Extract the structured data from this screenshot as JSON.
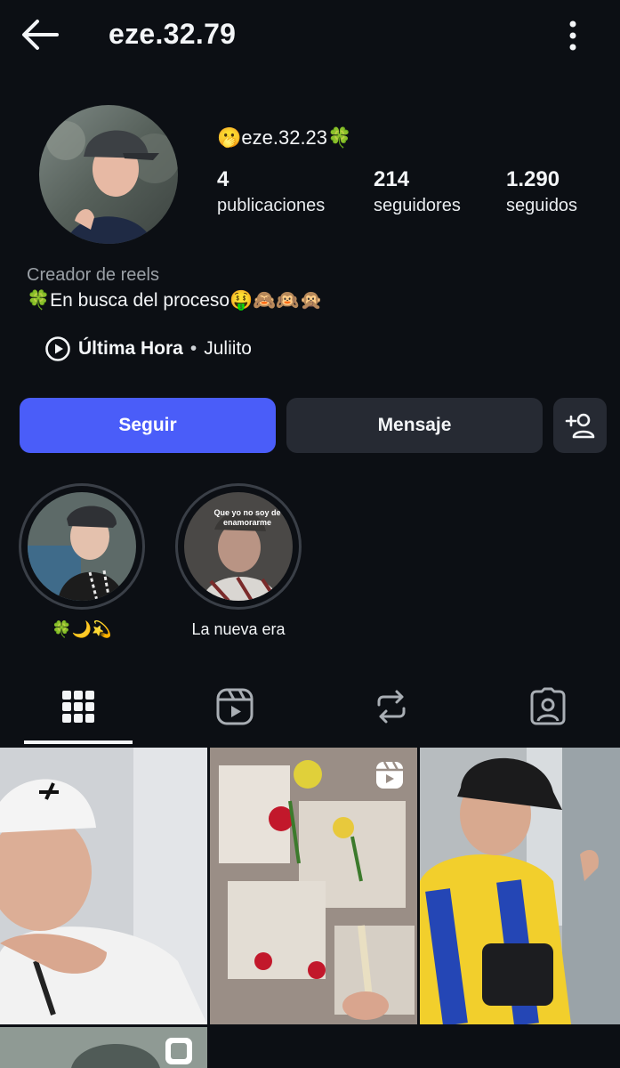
{
  "header": {
    "username": "eze.32.79",
    "back_icon": "arrow-left-icon",
    "more_icon": "more-vertical-icon"
  },
  "profile": {
    "display_name": "🫢eze.32.23🍀",
    "stats": [
      {
        "value": "4",
        "label": "publicaciones"
      },
      {
        "value": "214",
        "label": "seguidores"
      },
      {
        "value": "1.290",
        "label": "seguidos"
      }
    ],
    "category": "Creador de reels",
    "bio": "🍀En busca del proceso🤑🙈🙉🙊",
    "music": {
      "icon": "play-circle-icon",
      "song": "Última Hora",
      "separator": "•",
      "artist": "Juliito"
    }
  },
  "actions": {
    "follow_label": "Seguir",
    "message_label": "Mensaje",
    "add_user_icon": "add-person-icon",
    "follow_color": "#4a5df9"
  },
  "highlights": [
    {
      "label": "🍀🌙💫"
    },
    {
      "label": "La nueva era",
      "cover_text": "Que yo no soy de enamorarme"
    }
  ],
  "tabs": [
    {
      "icon": "grid-icon",
      "active": true
    },
    {
      "icon": "reels-icon",
      "active": false
    },
    {
      "icon": "reposts-icon",
      "active": false
    },
    {
      "icon": "tagged-icon",
      "active": false
    }
  ],
  "posts": [
    {
      "type": "photo",
      "description": "man in white cap"
    },
    {
      "type": "reel",
      "description": "flowers on niches"
    },
    {
      "type": "photo",
      "description": "man in blue and yellow jacket"
    },
    {
      "type": "photo",
      "description": "partial post"
    }
  ]
}
